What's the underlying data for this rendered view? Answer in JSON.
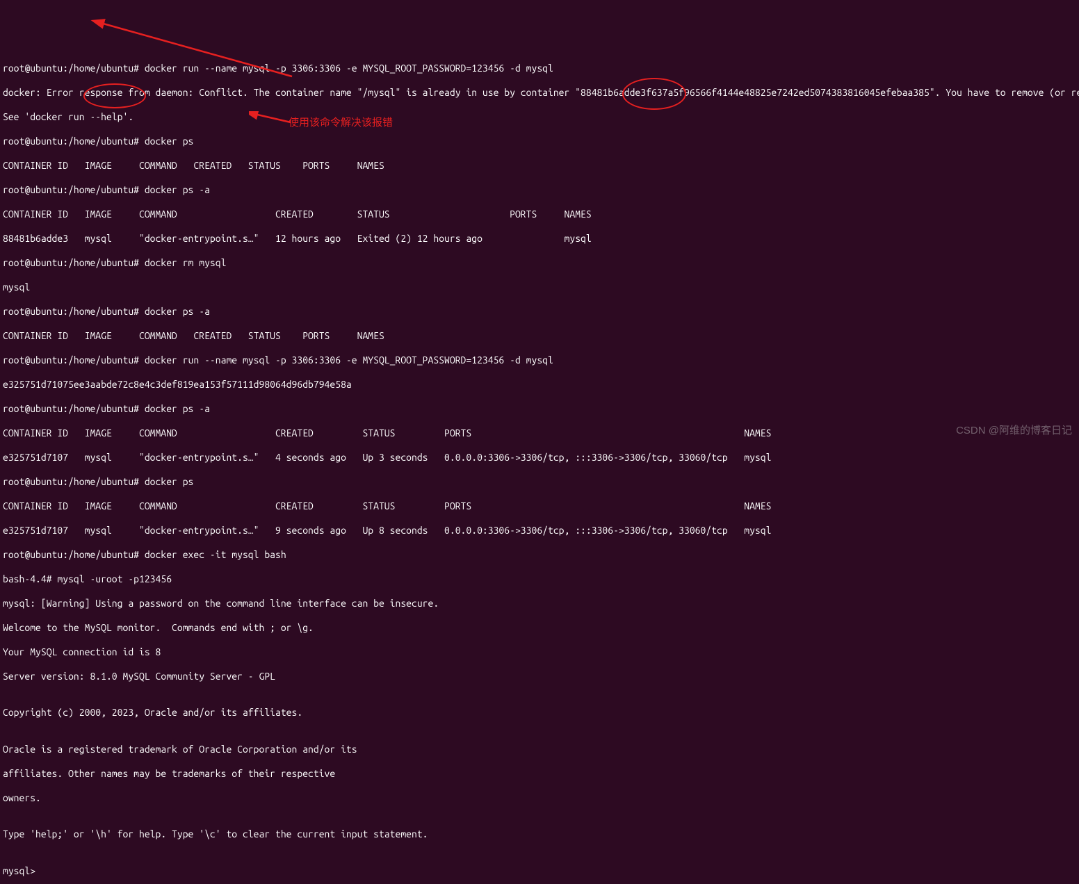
{
  "terminal": {
    "prompt": "root@ubuntu:/home/ubuntu#",
    "lines": {
      "l01": "root@ubuntu:/home/ubuntu# docker run --name mysql -p 3306:3306 -e MYSQL_ROOT_PASSWORD=123456 -d mysql",
      "l02": "docker: Error response from daemon: Conflict. The container name \"/mysql\" is already in use by container \"88481b6adde3f637a5f96566f4144e48825e7242ed5074383816045efebaa385\". You have to remove (or rename) that container to be able to reuse that name.",
      "l03": "See 'docker run --help'.",
      "l04": "root@ubuntu:/home/ubuntu# docker ps",
      "l05": "CONTAINER ID   IMAGE     COMMAND   CREATED   STATUS    PORTS     NAMES",
      "l06": "root@ubuntu:/home/ubuntu# docker ps -a",
      "l07": "CONTAINER ID   IMAGE     COMMAND                  CREATED        STATUS                      PORTS     NAMES",
      "l08": "88481b6adde3   mysql     \"docker-entrypoint.s…\"   12 hours ago   Exited (2) 12 hours ago               mysql",
      "l09": "root@ubuntu:/home/ubuntu# docker rm mysql",
      "l10": "mysql",
      "l11": "root@ubuntu:/home/ubuntu# docker ps -a",
      "l12": "CONTAINER ID   IMAGE     COMMAND   CREATED   STATUS    PORTS     NAMES",
      "l13": "root@ubuntu:/home/ubuntu# docker run --name mysql -p 3306:3306 -e MYSQL_ROOT_PASSWORD=123456 -d mysql",
      "l14": "e325751d71075ee3aabde72c8e4c3def819ea153f57111d98064d96db794e58a",
      "l15": "root@ubuntu:/home/ubuntu# docker ps -a",
      "l16": "CONTAINER ID   IMAGE     COMMAND                  CREATED         STATUS         PORTS                                                  NAMES",
      "l17": "e325751d7107   mysql     \"docker-entrypoint.s…\"   4 seconds ago   Up 3 seconds   0.0.0.0:3306->3306/tcp, :::3306->3306/tcp, 33060/tcp   mysql",
      "l18": "root@ubuntu:/home/ubuntu# docker ps",
      "l19": "CONTAINER ID   IMAGE     COMMAND                  CREATED         STATUS         PORTS                                                  NAMES",
      "l20": "e325751d7107   mysql     \"docker-entrypoint.s…\"   9 seconds ago   Up 8 seconds   0.0.0.0:3306->3306/tcp, :::3306->3306/tcp, 33060/tcp   mysql",
      "l21": "root@ubuntu:/home/ubuntu# docker exec -it mysql bash",
      "l22": "bash-4.4# mysql -uroot -p123456",
      "l23": "mysql: [Warning] Using a password on the command line interface can be insecure.",
      "l24": "Welcome to the MySQL monitor.  Commands end with ; or \\g.",
      "l25": "Your MySQL connection id is 8",
      "l26": "Server version: 8.1.0 MySQL Community Server - GPL",
      "l27": "",
      "l28": "Copyright (c) 2000, 2023, Oracle and/or its affiliates.",
      "l29": "",
      "l30": "Oracle is a registered trademark of Oracle Corporation and/or its",
      "l31": "affiliates. Other names may be trademarks of their respective",
      "l32": "owners.",
      "l33": "",
      "l34": "Type 'help;' or '\\h' for help. Type '\\c' to clear the current input statement.",
      "l35": "",
      "l36": "mysql>"
    }
  },
  "annotations": {
    "text1": "使用该命令解决该报错"
  },
  "watermark": "CSDN @阿维的博客日记"
}
